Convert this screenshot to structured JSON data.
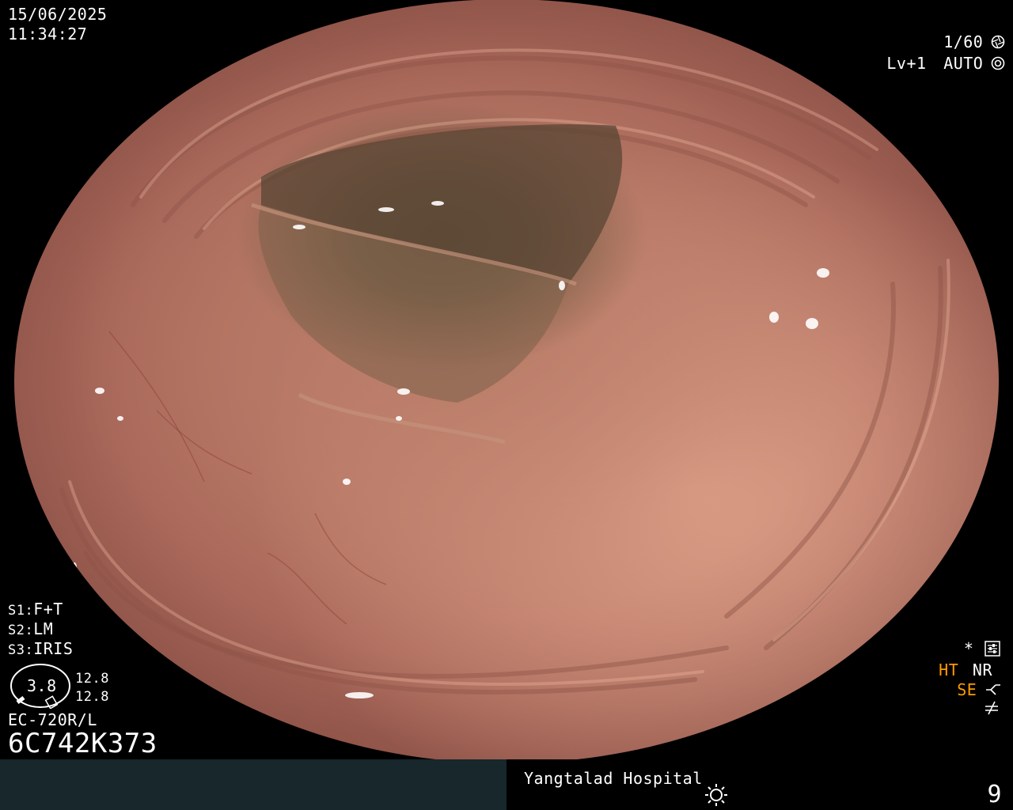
{
  "overlay": {
    "date": "15/06/2025",
    "time": "11:34:27",
    "shutter": "1/60",
    "level": "Lv+1",
    "exposure_mode": "AUTO",
    "settings": [
      {
        "key": "S1:",
        "value": "F+T"
      },
      {
        "key": "S2:",
        "value": "LM"
      },
      {
        "key": "S3:",
        "value": "IRIS"
      }
    ],
    "gauge_value": "3.8",
    "gauge_side_top": "12.8",
    "gauge_side_bottom": "12.8",
    "scope_model": "EC-720R/L",
    "serial": "6C742K373",
    "right_status": {
      "star": "*",
      "ht": "HT",
      "nr": "NR",
      "se": "SE"
    }
  },
  "footer": {
    "hospital": "Yangtalad Hospital",
    "number": "9"
  },
  "colors": {
    "accent": "#ff9a00",
    "footer_left_bg": "#17272b"
  }
}
